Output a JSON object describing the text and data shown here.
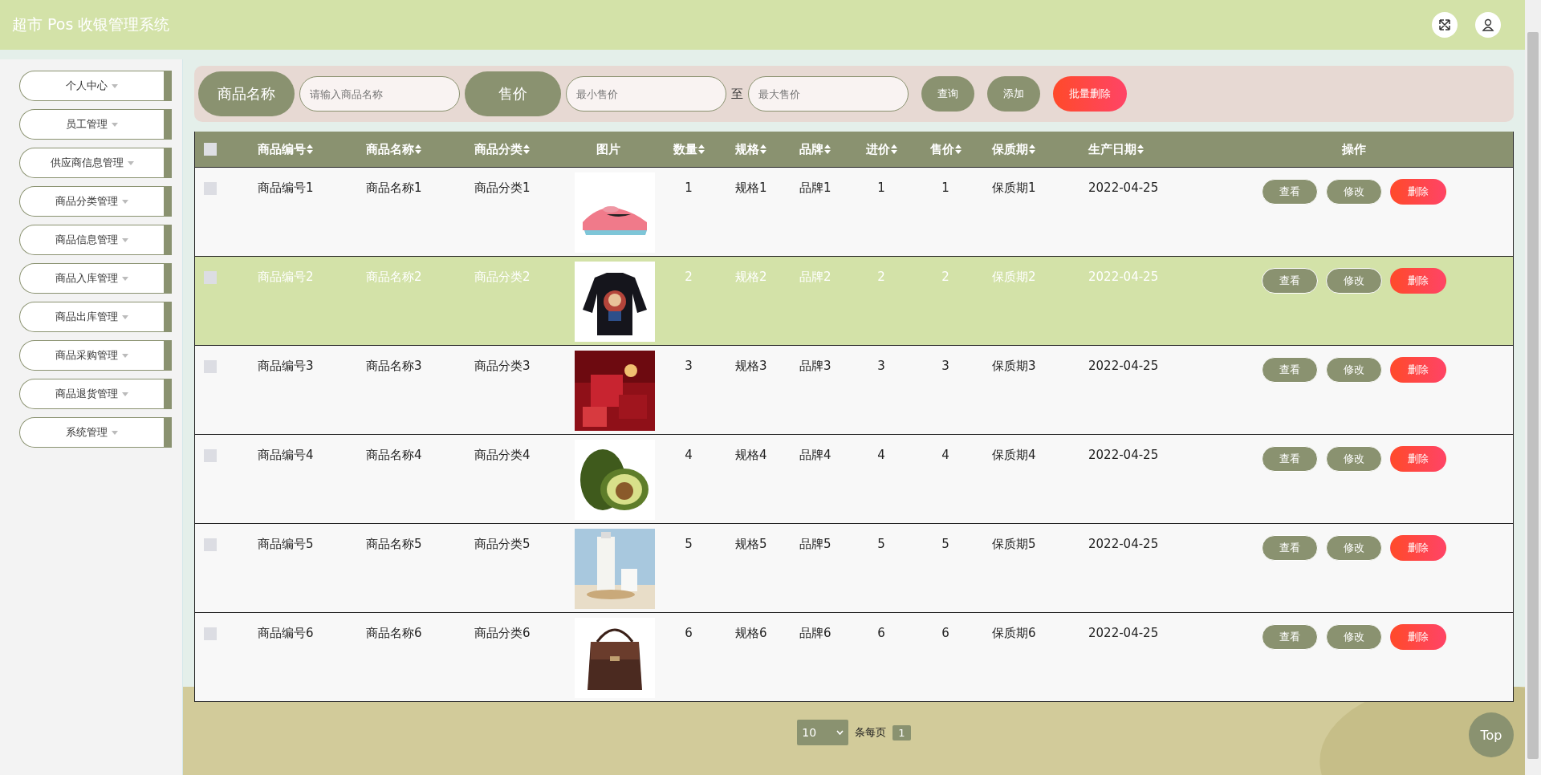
{
  "header": {
    "title": "超市 Pos 收银管理系统"
  },
  "sidebar": {
    "items": [
      {
        "label": "个人中心"
      },
      {
        "label": "员工管理"
      },
      {
        "label": "供应商信息管理"
      },
      {
        "label": "商品分类管理"
      },
      {
        "label": "商品信息管理"
      },
      {
        "label": "商品入库管理"
      },
      {
        "label": "商品出库管理"
      },
      {
        "label": "商品采购管理"
      },
      {
        "label": "商品退货管理"
      },
      {
        "label": "系统管理"
      }
    ]
  },
  "search": {
    "name_label": "商品名称",
    "name_placeholder": "请输入商品名称",
    "price_label": "售价",
    "min_placeholder": "最小售价",
    "to": "至",
    "max_placeholder": "最大售价",
    "buttons": [
      {
        "label": "查询",
        "kind": "normal"
      },
      {
        "label": "添加",
        "kind": "normal"
      },
      {
        "label": "批量删除",
        "kind": "danger"
      }
    ]
  },
  "table": {
    "select_all_checked": false,
    "columns": [
      {
        "label": "商品编号",
        "sortable": true
      },
      {
        "label": "商品名称",
        "sortable": true
      },
      {
        "label": "商品分类",
        "sortable": true
      },
      {
        "label": "图片",
        "sortable": false
      },
      {
        "label": "数量",
        "sortable": true
      },
      {
        "label": "规格",
        "sortable": true
      },
      {
        "label": "品牌",
        "sortable": true
      },
      {
        "label": "进价",
        "sortable": true
      },
      {
        "label": "售价",
        "sortable": true
      },
      {
        "label": "保质期",
        "sortable": true
      },
      {
        "label": "生产日期",
        "sortable": true
      },
      {
        "label": "操作",
        "sortable": false
      }
    ],
    "rows": [
      {
        "checked": false,
        "highlighted": false,
        "cells": [
          "商品编号1",
          "商品名称1",
          "商品分类1",
          null,
          "1",
          "规格1",
          "品牌1",
          "1",
          "1",
          "保质期1",
          "2022-04-25"
        ],
        "actions": [
          "查看",
          "修改",
          "删除"
        ]
      },
      {
        "checked": false,
        "highlighted": true,
        "cells": [
          "商品编号2",
          "商品名称2",
          "商品分类2",
          null,
          "2",
          "规格2",
          "品牌2",
          "2",
          "2",
          "保质期2",
          "2022-04-25"
        ],
        "actions": [
          "查看",
          "修改",
          "删除"
        ]
      },
      {
        "checked": false,
        "highlighted": false,
        "cells": [
          "商品编号3",
          "商品名称3",
          "商品分类3",
          null,
          "3",
          "规格3",
          "品牌3",
          "3",
          "3",
          "保质期3",
          "2022-04-25"
        ],
        "actions": [
          "查看",
          "修改",
          "删除"
        ]
      },
      {
        "checked": false,
        "highlighted": false,
        "cells": [
          "商品编号4",
          "商品名称4",
          "商品分类4",
          null,
          "4",
          "规格4",
          "品牌4",
          "4",
          "4",
          "保质期4",
          "2022-04-25"
        ],
        "actions": [
          "查看",
          "修改",
          "删除"
        ]
      },
      {
        "checked": false,
        "highlighted": false,
        "cells": [
          "商品编号5",
          "商品名称5",
          "商品分类5",
          null,
          "5",
          "规格5",
          "品牌5",
          "5",
          "5",
          "保质期5",
          "2022-04-25"
        ],
        "actions": [
          "查看",
          "修改",
          "删除"
        ]
      },
      {
        "checked": false,
        "highlighted": false,
        "cells": [
          "商品编号6",
          "商品名称6",
          "商品分类6",
          null,
          "6",
          "规格6",
          "品牌6",
          "6",
          "6",
          "保质期6",
          "2022-04-25"
        ],
        "actions": [
          "查看",
          "修改",
          "删除"
        ]
      }
    ]
  },
  "pagination": {
    "page_size": "10",
    "per_page_label": "条每页",
    "pages": [
      {
        "label": "1",
        "selected": true
      }
    ]
  },
  "top_button": "Top"
}
